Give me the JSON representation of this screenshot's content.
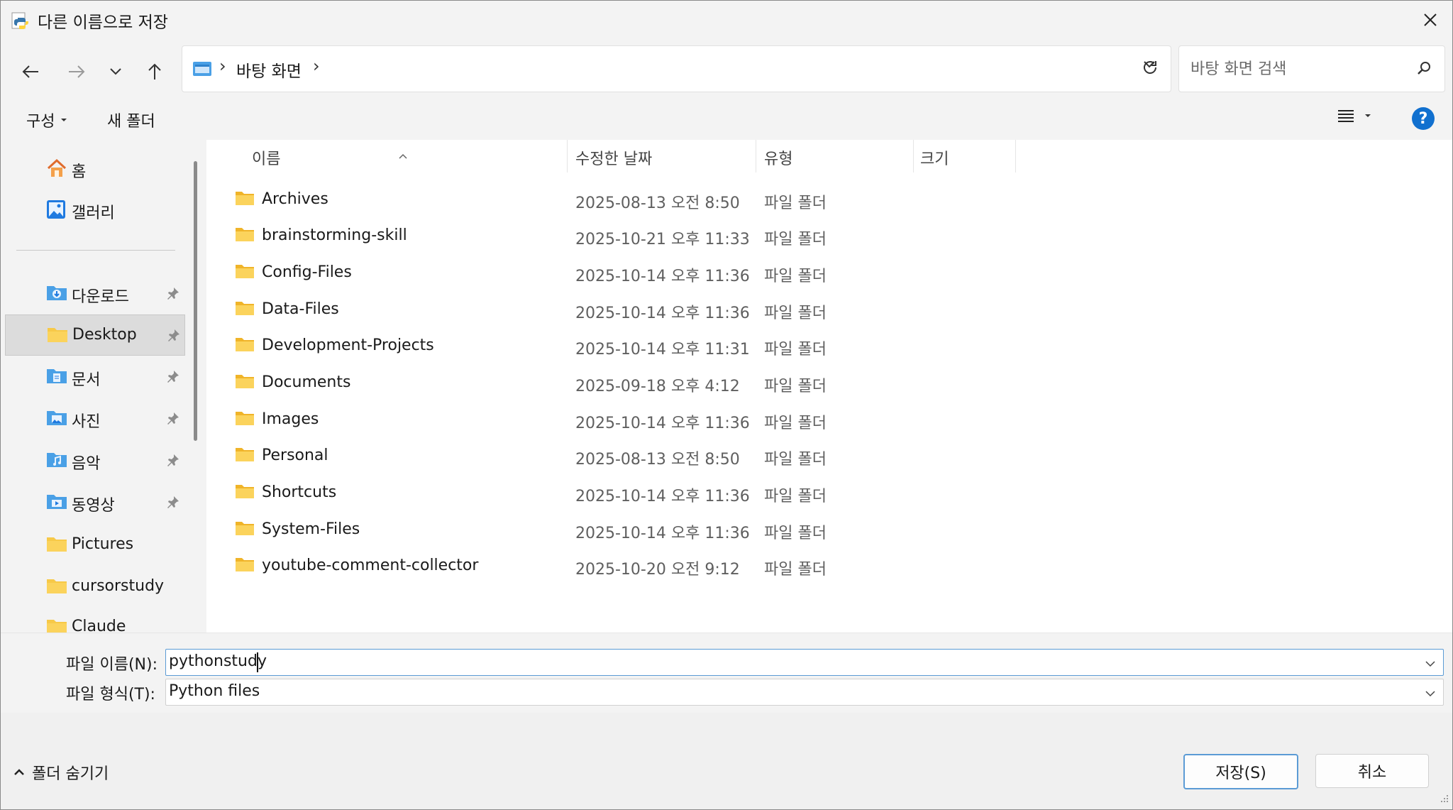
{
  "window": {
    "title": "다른 이름으로 저장"
  },
  "icons": {
    "app": "python-icon",
    "close": "close-icon",
    "back": "arrow-left-icon",
    "forward": "arrow-right-icon",
    "recent": "chevron-down-icon",
    "up": "arrow-up-icon",
    "refresh": "refresh-icon",
    "search": "search-icon",
    "view": "list-view-icon",
    "help": "help-icon",
    "folder": "folder-icon",
    "pin": "pin-icon"
  },
  "address": {
    "location": "바탕 화면"
  },
  "search": {
    "placeholder": "바탕 화면 검색"
  },
  "commands": {
    "organize": "구성",
    "new_folder": "새 폴더",
    "help": "?"
  },
  "sidebar": {
    "items": [
      {
        "label": "홈",
        "icon": "home-icon",
        "pinned": false
      },
      {
        "label": "갤러리",
        "icon": "gallery-icon",
        "pinned": false
      },
      {
        "label": "다운로드",
        "icon": "downloads-folder-icon",
        "pinned": true
      },
      {
        "label": "Desktop",
        "icon": "folder-icon",
        "pinned": true,
        "selected": true
      },
      {
        "label": "문서",
        "icon": "documents-folder-icon",
        "pinned": true
      },
      {
        "label": "사진",
        "icon": "pictures-folder-icon",
        "pinned": true
      },
      {
        "label": "음악",
        "icon": "music-folder-icon",
        "pinned": true
      },
      {
        "label": "동영상",
        "icon": "videos-folder-icon",
        "pinned": true
      },
      {
        "label": "Pictures",
        "icon": "folder-icon",
        "pinned": false
      },
      {
        "label": "cursorstudy",
        "icon": "folder-icon",
        "pinned": false
      },
      {
        "label": "Claude",
        "icon": "folder-icon",
        "pinned": false
      }
    ]
  },
  "columns": {
    "name": "이름",
    "modified": "수정한 날짜",
    "type": "유형",
    "size": "크기"
  },
  "files": [
    {
      "name": "Archives",
      "modified": "2025-08-13 오전 8:50",
      "type": "파일 폴더"
    },
    {
      "name": "brainstorming-skill",
      "modified": "2025-10-21 오후 11:33",
      "type": "파일 폴더"
    },
    {
      "name": "Config-Files",
      "modified": "2025-10-14 오후 11:36",
      "type": "파일 폴더"
    },
    {
      "name": "Data-Files",
      "modified": "2025-10-14 오후 11:36",
      "type": "파일 폴더"
    },
    {
      "name": "Development-Projects",
      "modified": "2025-10-14 오후 11:31",
      "type": "파일 폴더"
    },
    {
      "name": "Documents",
      "modified": "2025-09-18 오후 4:12",
      "type": "파일 폴더"
    },
    {
      "name": "Images",
      "modified": "2025-10-14 오후 11:36",
      "type": "파일 폴더"
    },
    {
      "name": "Personal",
      "modified": "2025-08-13 오전 8:50",
      "type": "파일 폴더"
    },
    {
      "name": "Shortcuts",
      "modified": "2025-10-14 오후 11:36",
      "type": "파일 폴더"
    },
    {
      "name": "System-Files",
      "modified": "2025-10-14 오후 11:36",
      "type": "파일 폴더"
    },
    {
      "name": "youtube-comment-collector",
      "modified": "2025-10-20 오전 9:12",
      "type": "파일 폴더"
    }
  ],
  "form": {
    "filename_label": "파일 이름(N):",
    "filename_value": "pythonstudy",
    "filetype_label": "파일 형식(T):",
    "filetype_value": "Python files"
  },
  "footer": {
    "hide_folders": "폴더 숨기기",
    "save": "저장(S)",
    "cancel": "취소"
  },
  "colors": {
    "accent": "#1170cf",
    "selected_bg": "#dcdcdc",
    "folder": "#f7c948"
  }
}
